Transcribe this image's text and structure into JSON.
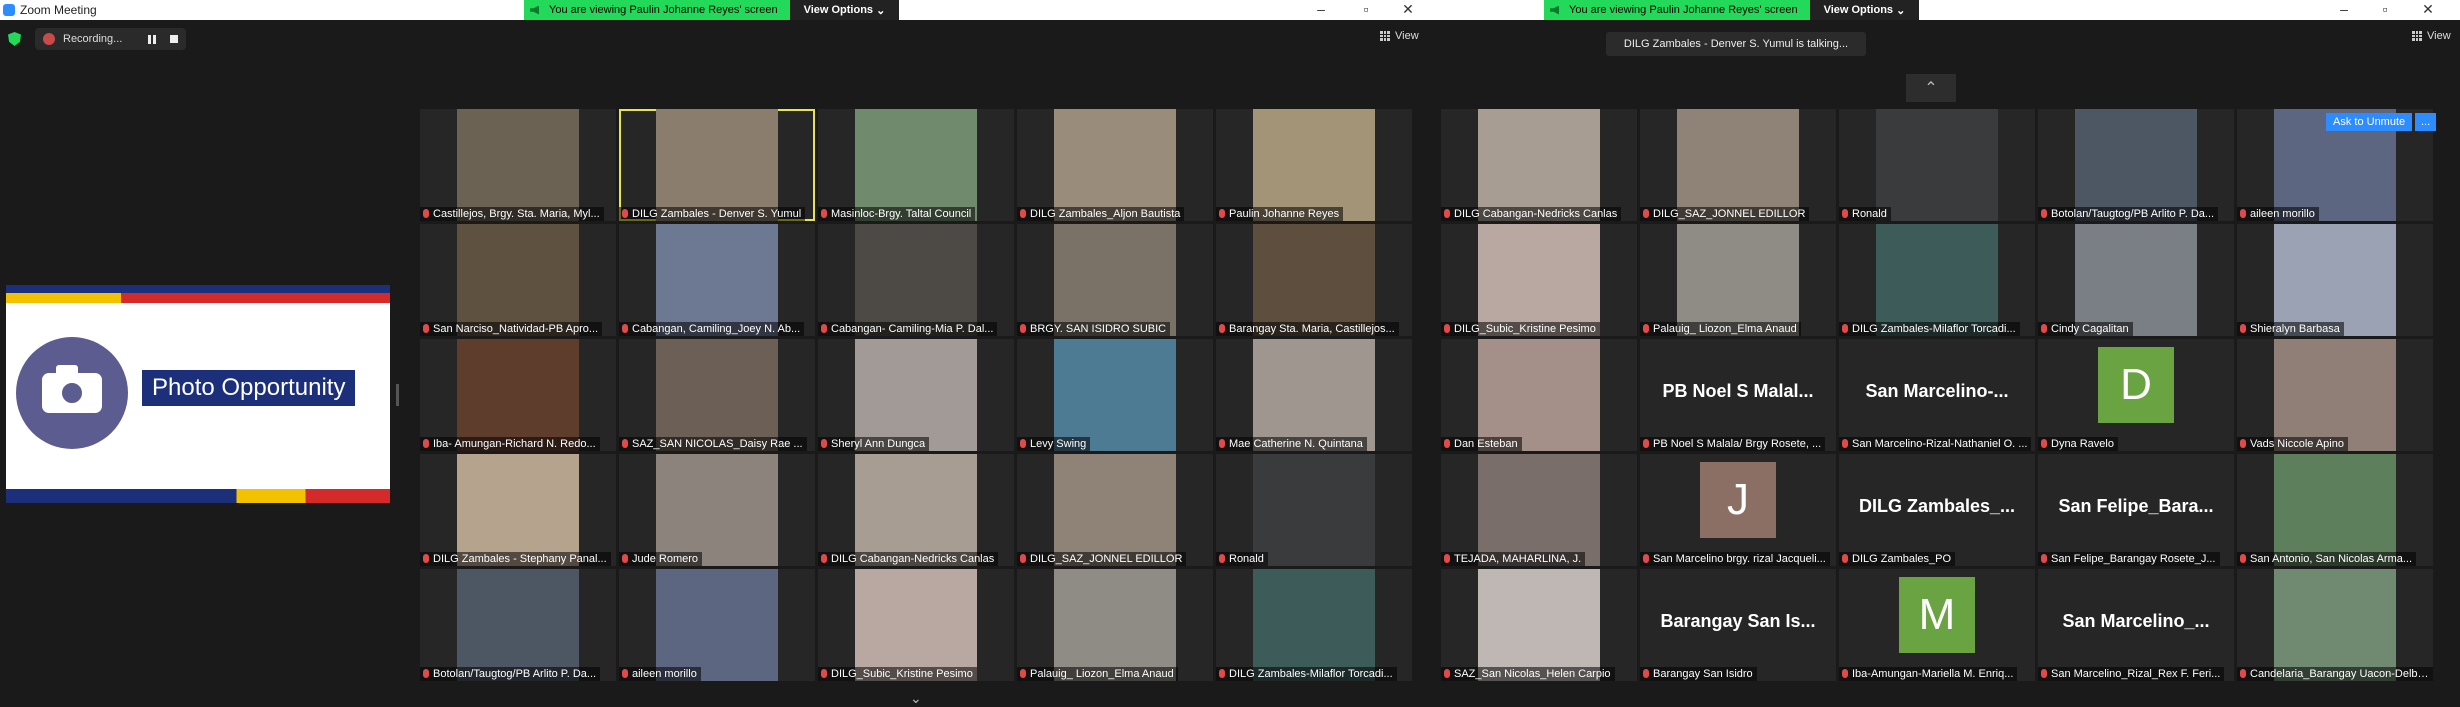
{
  "window": {
    "title": "Zoom Meeting"
  },
  "share_banner": {
    "message": "You are viewing Paulin Johanne Reyes' screen",
    "view_options": "View Options"
  },
  "recording": {
    "label": "Recording..."
  },
  "view": {
    "label": "View"
  },
  "talking": "DILG Zambales - Denver S. Yumul is talking...",
  "slide": {
    "title": "Photo Opportunity"
  },
  "right_controls": {
    "ask_unmute": "Ask to Unmute",
    "more": "..."
  },
  "colors": {
    "share_green": "#23d959",
    "zoom_blue": "#2d8cff",
    "muted_red": "#e24a4a",
    "highlight": "#e6e64a"
  },
  "left_tiles": [
    {
      "name": "Castillejos, Brgy. Sta. Maria, Myl...",
      "bg": "#6b6253"
    },
    {
      "name": "DILG Zambales - Denver S. Yumul",
      "bg": "#8a7d6d",
      "highlight": true
    },
    {
      "name": "Masinloc-Brgy. Taltal Council",
      "bg": "#6f8a6c"
    },
    {
      "name": "DILG Zambales_Aljon Bautista",
      "bg": "#9a8c7a"
    },
    {
      "name": "Paulin Johanne Reyes",
      "bg": "#a49477"
    },
    {
      "name": "San Narciso_Natividad-PB Apro...",
      "bg": "#5e5140"
    },
    {
      "name": "Cabangan, Camiling_Joey N. Ab...",
      "bg": "#6d7992"
    },
    {
      "name": "Cabangan- Camiling-Mia P. Dal...",
      "bg": "#4d4944"
    },
    {
      "name": "BRGY. SAN ISIDRO SUBIC",
      "bg": "#7a7266"
    },
    {
      "name": "Barangay Sta. Maria, Castillejos...",
      "bg": "#5e4e3d"
    },
    {
      "name": "Iba- Amungan-Richard N. Redo...",
      "bg": "#5f3d2d"
    },
    {
      "name": "SAZ_SAN NICOLAS_Daisy Rae ...",
      "bg": "#6c5f55"
    },
    {
      "name": "Sheryl Ann Dungca",
      "bg": "#a29a96"
    },
    {
      "name": "Levy Swing",
      "bg": "#4d7b94"
    },
    {
      "name": "Mae Catherine N. Quintana",
      "bg": "#9e968f"
    },
    {
      "name": "DILG Zambales - Stephany Panal...",
      "bg": "#b5a38e"
    },
    {
      "name": "Jude Romero",
      "bg": "#8c847c"
    },
    {
      "name": "DILG Cabangan-Nedricks Canlas",
      "bg": "#a89d92"
    },
    {
      "name": "DILG_SAZ_JONNEL EDILLOR",
      "bg": "#8f8276"
    },
    {
      "name": "Ronald",
      "bg": "#3a3b3d"
    },
    {
      "name": "Botolan/Taugtog/PB Arlito P. Da...",
      "bg": "#4d5663"
    },
    {
      "name": "aileen morillo",
      "bg": "#5c6680"
    },
    {
      "name": "DILG_Subic_Kristine Pesimo",
      "bg": "#b9a8a2"
    },
    {
      "name": "Palauig_ Liozon_Elma Anaud",
      "bg": "#8f8c86"
    },
    {
      "name": "DILG Zambales-Milaflor Torcadi...",
      "bg": "#3d5b59"
    }
  ],
  "right_tiles": [
    {
      "name": "DILG Cabangan-Nedricks Canlas",
      "bg": "#a89d92"
    },
    {
      "name": "DILG_SAZ_JONNEL EDILLOR",
      "bg": "#8f8276"
    },
    {
      "name": "Ronald",
      "bg": "#3a3b3d"
    },
    {
      "name": "Botolan/Taugtog/PB Arlito P. Da...",
      "bg": "#4d5663"
    },
    {
      "name": "aileen morillo",
      "bg": "#5c6680"
    },
    {
      "name": "DILG_Subic_Kristine Pesimo",
      "bg": "#b9a8a2"
    },
    {
      "name": "Palauig_ Liozon_Elma Anaud",
      "bg": "#8f8c86"
    },
    {
      "name": "DILG Zambales-Milaflor Torcadi...",
      "bg": "#3d5b59"
    },
    {
      "name": "Cindy Cagalitan",
      "bg": "#7a7f86"
    },
    {
      "name": "Shieralyn Barbasa",
      "bg": "#9aa2b4"
    },
    {
      "name": "Dan Esteban",
      "bg": "#a49088"
    },
    {
      "name": "PB Noel S Malala/ Brgy Rosete, ...",
      "big": "PB Noel S Malal..."
    },
    {
      "name": "San Marcelino-Rizal-Nathaniel O. ...",
      "big": "San Marcelino-..."
    },
    {
      "name": "Dyna Ravelo",
      "avatar": "D",
      "avatar_color": "#6aa442"
    },
    {
      "name": "Vads Niccole Apino",
      "bg": "#8f7f76"
    },
    {
      "name": "TEJADA, MAHARLINA, J.",
      "bg": "#7a6e6a"
    },
    {
      "name": "San Marcelino brgy. rizal Jacqueli...",
      "avatar": "J",
      "avatar_color": "#8b6f64"
    },
    {
      "name": "DILG Zambales_PO",
      "big": "DILG Zambales_..."
    },
    {
      "name": "San Felipe_Barangay Rosete_J...",
      "big": "San Felipe_Bara..."
    },
    {
      "name": "San Antonio, San Nicolas Arma...",
      "bg": "#5d7f5b"
    },
    {
      "name": "SAZ_San Nicolas_Helen Carpio",
      "bg": "#bfb7b4"
    },
    {
      "name": "Barangay San Isidro",
      "big": "Barangay San Is..."
    },
    {
      "name": "Iba-Amungan-Mariella M. Enriq...",
      "avatar": "M",
      "avatar_color": "#6aa442"
    },
    {
      "name": "San Marcelino_Rizal_Rex F. Feri...",
      "big": "San Marcelino_..."
    },
    {
      "name": "Candelaria_Barangay Uacon-Delbe...",
      "bg": "#6f8a70"
    }
  ]
}
